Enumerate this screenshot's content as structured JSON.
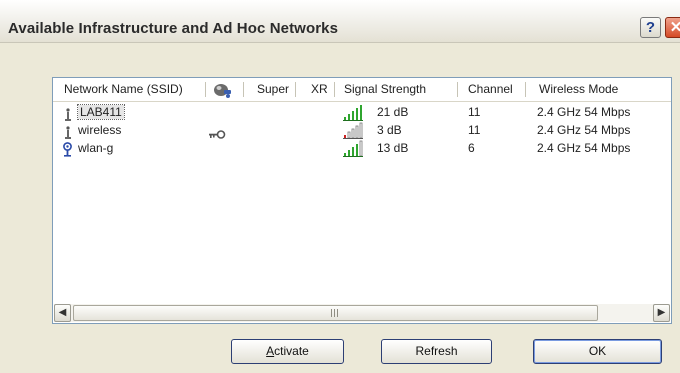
{
  "window": {
    "title": "Available Infrastructure and Ad Hoc Networks",
    "help_label": "?",
    "close_label": "✕"
  },
  "list": {
    "columns": [
      "Network Name (SSID)",
      "",
      "Super",
      "XR",
      "Signal Strength",
      "Channel",
      "Wireless Mode"
    ],
    "rows": [
      {
        "ssid": "LAB411",
        "network_icon": "infrastructure-antenna-icon",
        "encrypted": false,
        "signal_level": 5,
        "signal": "21 dB",
        "channel": "11",
        "mode": "2.4 GHz 54 Mbps",
        "selected": true
      },
      {
        "ssid": "wireless",
        "network_icon": "infrastructure-antenna-icon",
        "encrypted": true,
        "signal_level": 1,
        "signal": "3 dB",
        "channel": "11",
        "mode": "2.4 GHz 54 Mbps",
        "selected": false
      },
      {
        "ssid": "wlan-g",
        "network_icon": "adhoc-icon",
        "encrypted": false,
        "signal_level": 4,
        "signal": "13 dB",
        "channel": "6",
        "mode": "2.4 GHz 54 Mbps",
        "selected": false
      }
    ]
  },
  "buttons": {
    "activate": {
      "label": "ctivate",
      "mnemonic": "A"
    },
    "refresh": "Refresh",
    "ok": "OK"
  },
  "colors": {
    "signal_green": "#2fa52f",
    "signal_red": "#cc2222",
    "accent_border": "#2d3f74"
  }
}
